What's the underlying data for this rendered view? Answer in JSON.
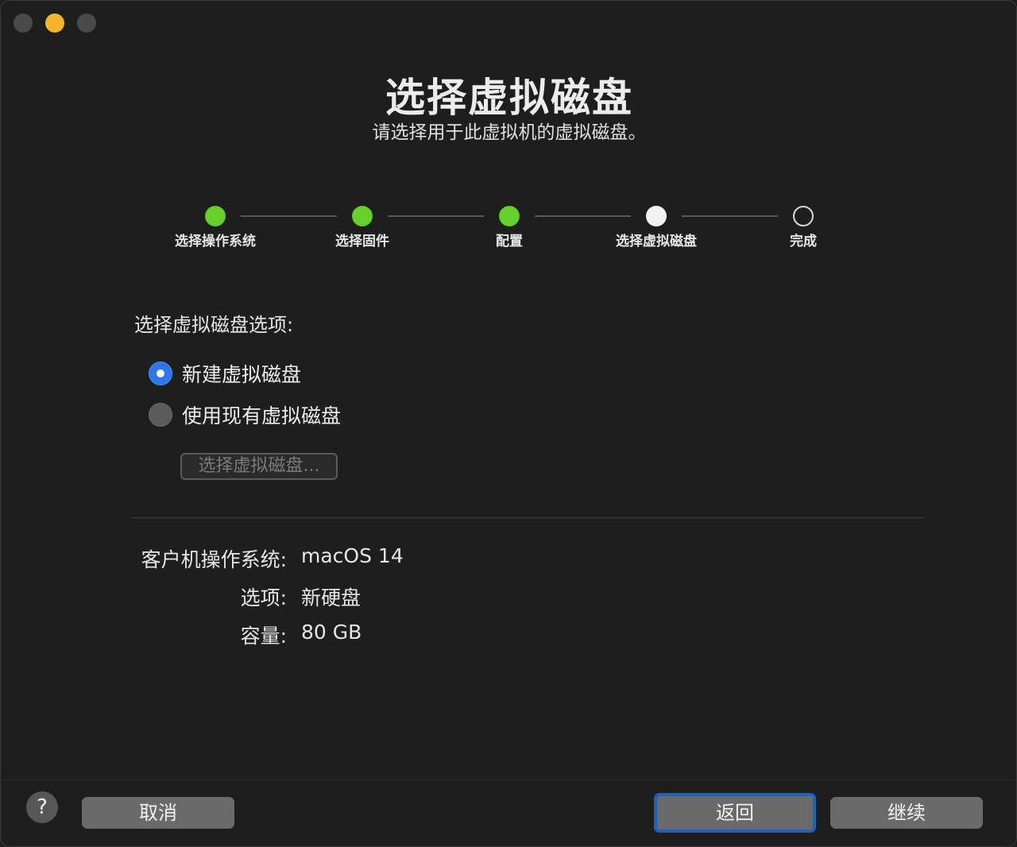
{
  "header": {
    "title": "选择虚拟磁盘",
    "subtitle": "请选择用于此虚拟机的虚拟磁盘。"
  },
  "steps": [
    {
      "label": "选择操作系统",
      "state": "done"
    },
    {
      "label": "选择固件",
      "state": "done"
    },
    {
      "label": "配置",
      "state": "done"
    },
    {
      "label": "选择虚拟磁盘",
      "state": "current"
    },
    {
      "label": "完成",
      "state": "todo"
    }
  ],
  "options": {
    "section_label": "选择虚拟磁盘选项:",
    "new_disk_label": "新建虚拟磁盘",
    "existing_disk_label": "使用现有虚拟磁盘",
    "selected": "new_disk",
    "choose_button_label": "选择虚拟磁盘..."
  },
  "summary": {
    "guest_os_key": "客户机操作系统:",
    "guest_os_value": "macOS 14",
    "option_key": "选项:",
    "option_value": "新硬盘",
    "capacity_key": "容量:",
    "capacity_value": "80 GB"
  },
  "footer": {
    "help_label": "?",
    "cancel_label": "取消",
    "back_label": "返回",
    "continue_label": "继续"
  },
  "colors": {
    "step_done": "#66d02c",
    "radio_selected": "#2f76e8",
    "focus_ring": "#1f63b8",
    "minimize": "#f6b52e"
  }
}
